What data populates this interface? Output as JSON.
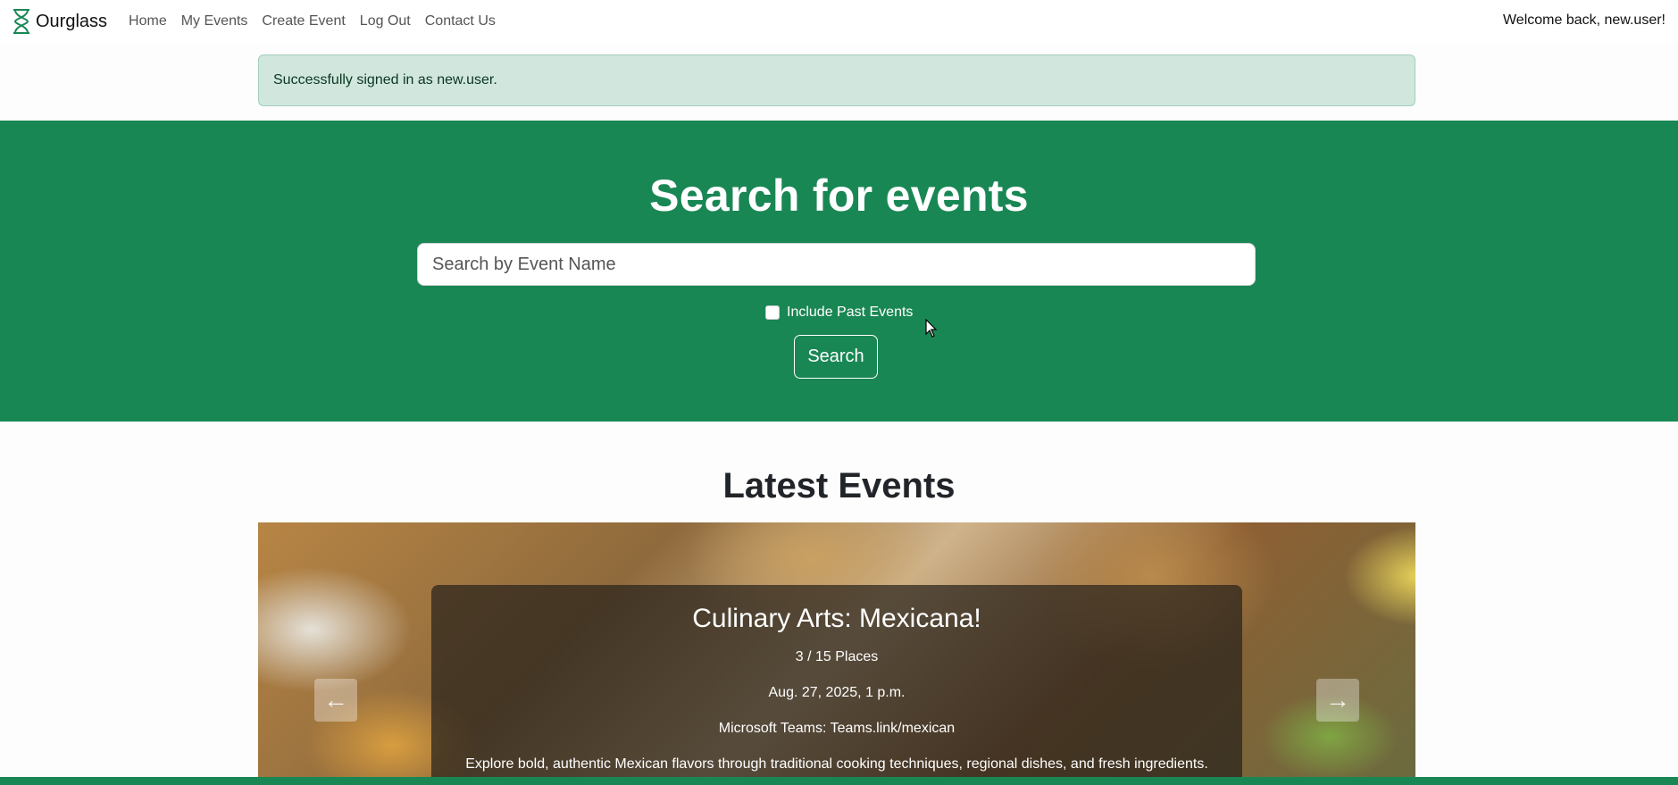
{
  "brand": {
    "name": "Ourglass",
    "icon": "hourglass-icon"
  },
  "nav": {
    "items": [
      "Home",
      "My Events",
      "Create Event",
      "Log Out",
      "Contact Us"
    ]
  },
  "welcome": "Welcome back, new.user!",
  "alert": "Successfully signed in as new.user.",
  "hero": {
    "title": "Search for events",
    "search_placeholder": "Search by Event Name",
    "checkbox_label": "Include Past Events",
    "button": "Search"
  },
  "latest": {
    "title": "Latest Events",
    "event": {
      "title": "Culinary Arts: Mexicana!",
      "places": "3 / 15 Places",
      "date": "Aug. 27, 2025, 1 p.m.",
      "location": "Microsoft Teams: Teams.link/mexican",
      "description": "Explore bold, authentic Mexican flavors through traditional cooking techniques, regional dishes, and fresh ingredients."
    },
    "prev_icon": "arrow-left-icon",
    "next_icon": "arrow-right-icon"
  },
  "colors": {
    "primary": "#198754",
    "alert_bg": "#d1e7dd"
  }
}
